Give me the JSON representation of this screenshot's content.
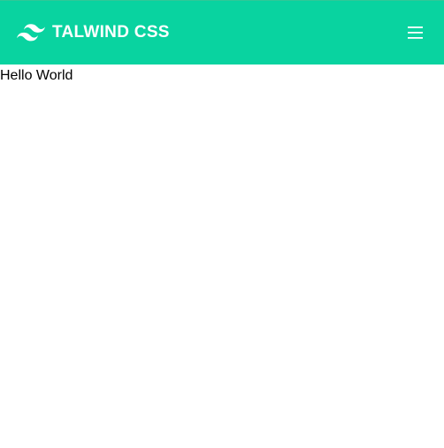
{
  "navbar": {
    "brand_text": "TALWIND CSS",
    "logo_icon": "tailwind-logo-icon",
    "menu_icon": "hamburger-menu-icon",
    "background_color": "#09d3a0",
    "text_color": "#ffffff"
  },
  "main": {
    "text": "Hello World"
  }
}
